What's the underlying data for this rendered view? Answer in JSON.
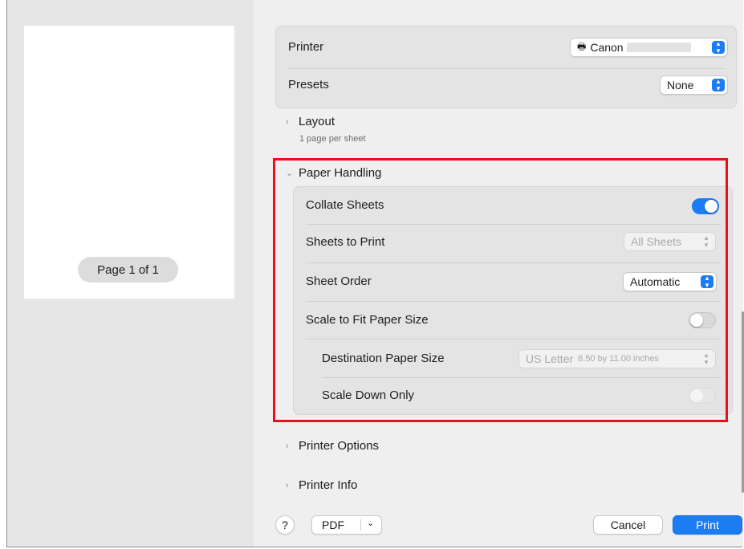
{
  "preview": {
    "page_indicator": "Page 1 of 1"
  },
  "printer": {
    "label": "Printer",
    "value": "Canon"
  },
  "presets": {
    "label": "Presets",
    "value": "None"
  },
  "layout": {
    "title": "Layout",
    "summary": "1 page per sheet"
  },
  "paper_handling": {
    "title": "Paper Handling",
    "collate": {
      "label": "Collate Sheets",
      "on": true
    },
    "sheets_to_print": {
      "label": "Sheets to Print",
      "value": "All Sheets"
    },
    "sheet_order": {
      "label": "Sheet Order",
      "value": "Automatic"
    },
    "scale_to_fit": {
      "label": "Scale to Fit Paper Size",
      "on": false
    },
    "destination": {
      "label": "Destination Paper Size",
      "value": "US Letter",
      "detail": "8.50 by 11.00 inches"
    },
    "scale_down": {
      "label": "Scale Down Only",
      "on": false
    }
  },
  "printer_options": {
    "title": "Printer Options"
  },
  "printer_info": {
    "title": "Printer Info"
  },
  "footer": {
    "help": "?",
    "pdf": "PDF",
    "cancel": "Cancel",
    "print": "Print"
  },
  "colors": {
    "accent": "#1c7cf4",
    "highlight": "#e8101a"
  }
}
